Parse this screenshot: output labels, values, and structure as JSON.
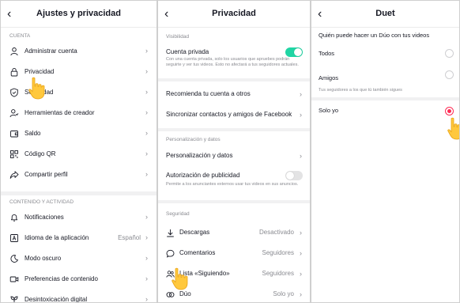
{
  "panel1": {
    "title": "Ajustes y privacidad",
    "section_cuenta": "CUENTA",
    "items": [
      {
        "label": "Administrar cuenta"
      },
      {
        "label": "Privacidad"
      },
      {
        "label": "Seguridad"
      },
      {
        "label": "Herramientas de creador"
      },
      {
        "label": "Saldo"
      },
      {
        "label": "Código QR"
      },
      {
        "label": "Compartir perfil"
      }
    ],
    "section_contenido": "CONTENIDO Y ACTIVIDAD",
    "items2": [
      {
        "label": "Notificaciones",
        "value": ""
      },
      {
        "label": "Idioma de la aplicación",
        "value": "Español"
      },
      {
        "label": "Modo oscuro",
        "value": ""
      },
      {
        "label": "Preferencias de contenido",
        "value": ""
      },
      {
        "label": "Desintoxicación digital",
        "value": ""
      }
    ]
  },
  "panel2": {
    "title": "Privacidad",
    "section_visibilidad": "Visibilidad",
    "private_account": {
      "label": "Cuenta privada",
      "description": "Con una cuenta privada, solo los usuarios que apruebes podrán seguirte y ver tus videos. Esto no afectará a tus seguidores actuales."
    },
    "recommend": "Recomienda tu cuenta a otros",
    "sync": "Sincronizar contactos y amigos de Facebook",
    "section_personalizacion": "Personalización y datos",
    "personalization": "Personalización y datos",
    "ads": {
      "label": "Autorización de publicidad",
      "description": "Permite a los anunciantes externos usar tus videos en sus anuncios."
    },
    "section_seguridad": "Seguridad",
    "security_items": [
      {
        "label": "Descargas",
        "value": "Desactivado"
      },
      {
        "label": "Comentarios",
        "value": "Seguidores"
      },
      {
        "label": "Lista «Siguiendo»",
        "value": "Seguidores"
      },
      {
        "label": "Dúo",
        "value": "Solo yo"
      }
    ]
  },
  "panel3": {
    "title": "Duet",
    "question": "Quién puede hacer un Dúo con tus videos",
    "options": [
      {
        "label": "Todos",
        "desc": ""
      },
      {
        "label": "Amigos",
        "desc": "Tus seguidores a los que tú también sigues"
      },
      {
        "label": "Solo yo",
        "desc": ""
      }
    ],
    "selected_index": 2
  },
  "colors": {
    "accent": "#fe2c55",
    "toggle_on": "#20d5a4",
    "secondary_text": "#8a8b91",
    "hand": "#ffc83d"
  },
  "icons": {
    "back": "‹",
    "chevron": "›"
  }
}
